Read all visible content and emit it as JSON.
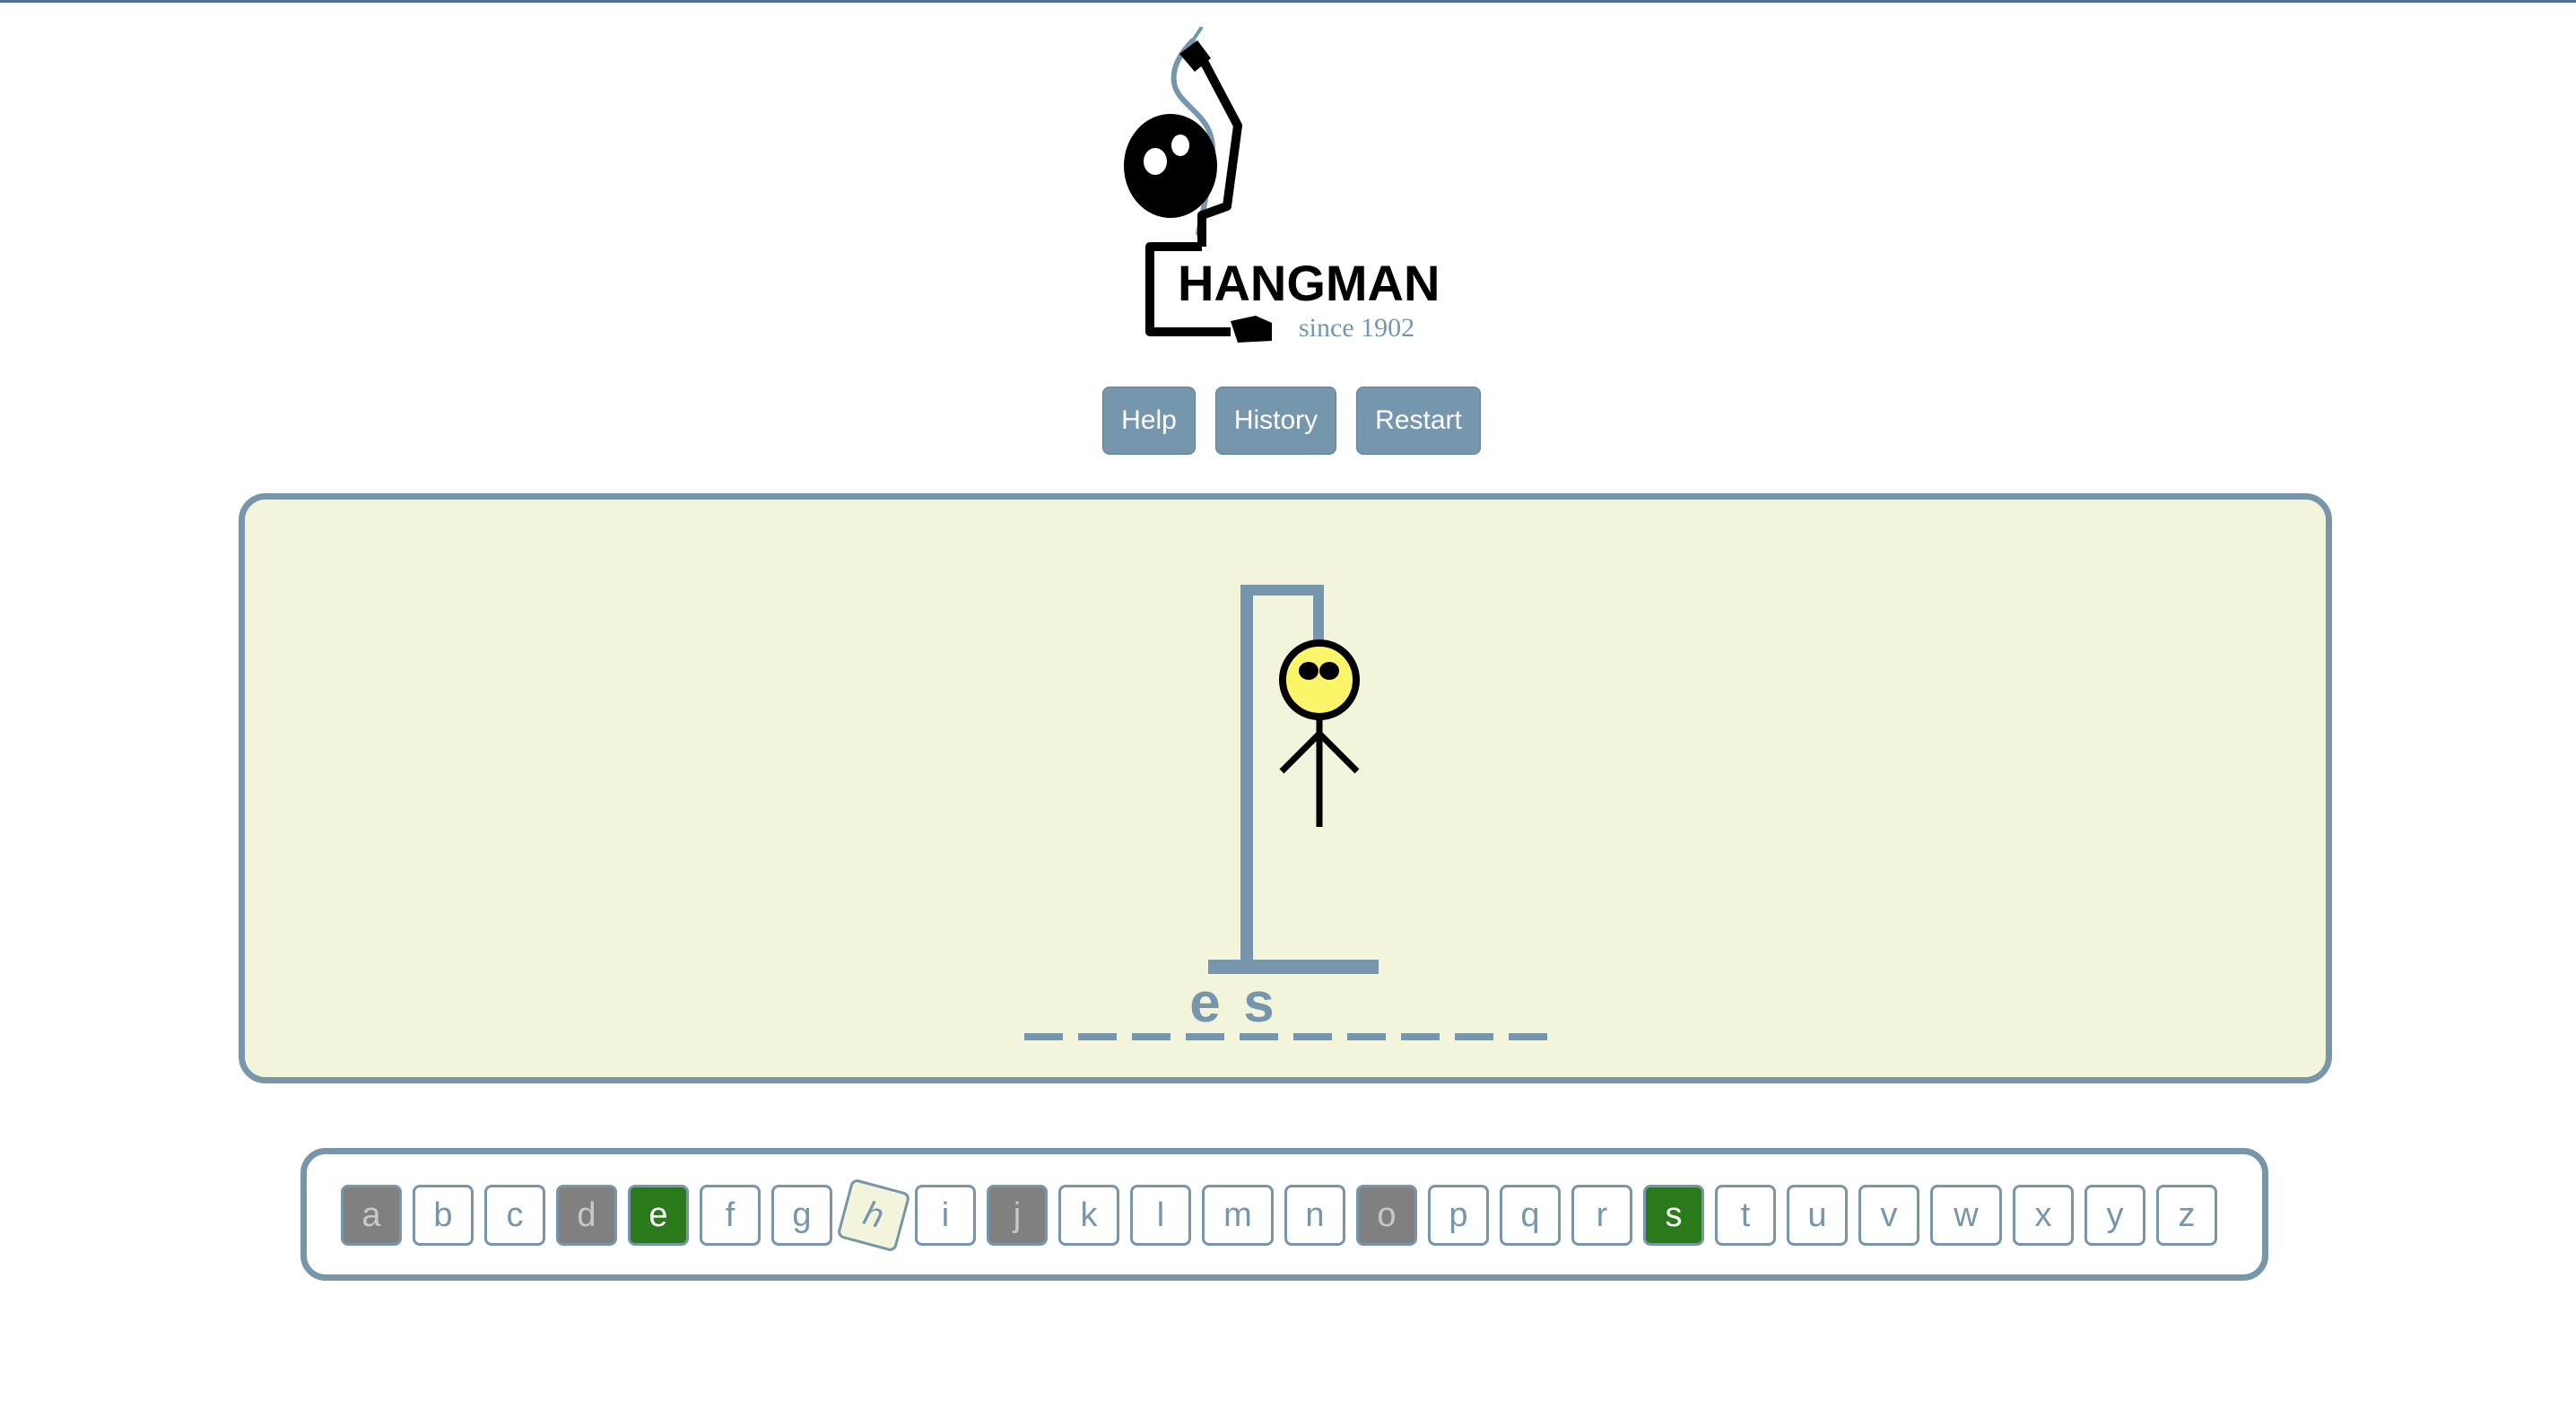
{
  "logo": {
    "title": "HANGMAN",
    "tagline": "since 1902"
  },
  "nav": {
    "help": "Help",
    "history": "History",
    "restart": "Restart"
  },
  "word": {
    "slots": [
      "",
      "",
      "",
      "e",
      "s",
      "",
      "",
      "",
      "",
      ""
    ]
  },
  "keyboard": {
    "keys": [
      {
        "letter": "a",
        "state": "wrong"
      },
      {
        "letter": "b",
        "state": "unused"
      },
      {
        "letter": "c",
        "state": "unused"
      },
      {
        "letter": "d",
        "state": "wrong"
      },
      {
        "letter": "e",
        "state": "right"
      },
      {
        "letter": "f",
        "state": "unused"
      },
      {
        "letter": "g",
        "state": "unused"
      },
      {
        "letter": "h",
        "state": "hover"
      },
      {
        "letter": "i",
        "state": "unused"
      },
      {
        "letter": "j",
        "state": "wrong"
      },
      {
        "letter": "k",
        "state": "unused"
      },
      {
        "letter": "l",
        "state": "unused"
      },
      {
        "letter": "m",
        "state": "unused"
      },
      {
        "letter": "n",
        "state": "unused"
      },
      {
        "letter": "o",
        "state": "wrong"
      },
      {
        "letter": "p",
        "state": "unused"
      },
      {
        "letter": "q",
        "state": "unused"
      },
      {
        "letter": "r",
        "state": "unused"
      },
      {
        "letter": "s",
        "state": "right"
      },
      {
        "letter": "t",
        "state": "unused"
      },
      {
        "letter": "u",
        "state": "unused"
      },
      {
        "letter": "v",
        "state": "unused"
      },
      {
        "letter": "w",
        "state": "unused"
      },
      {
        "letter": "x",
        "state": "unused"
      },
      {
        "letter": "y",
        "state": "unused"
      },
      {
        "letter": "z",
        "state": "unused"
      }
    ]
  },
  "colors": {
    "accent": "#7596ac",
    "board_bg": "#f3f4dc",
    "correct": "#2a7a1c",
    "wrong": "#808080",
    "face": "#fbf56a"
  }
}
